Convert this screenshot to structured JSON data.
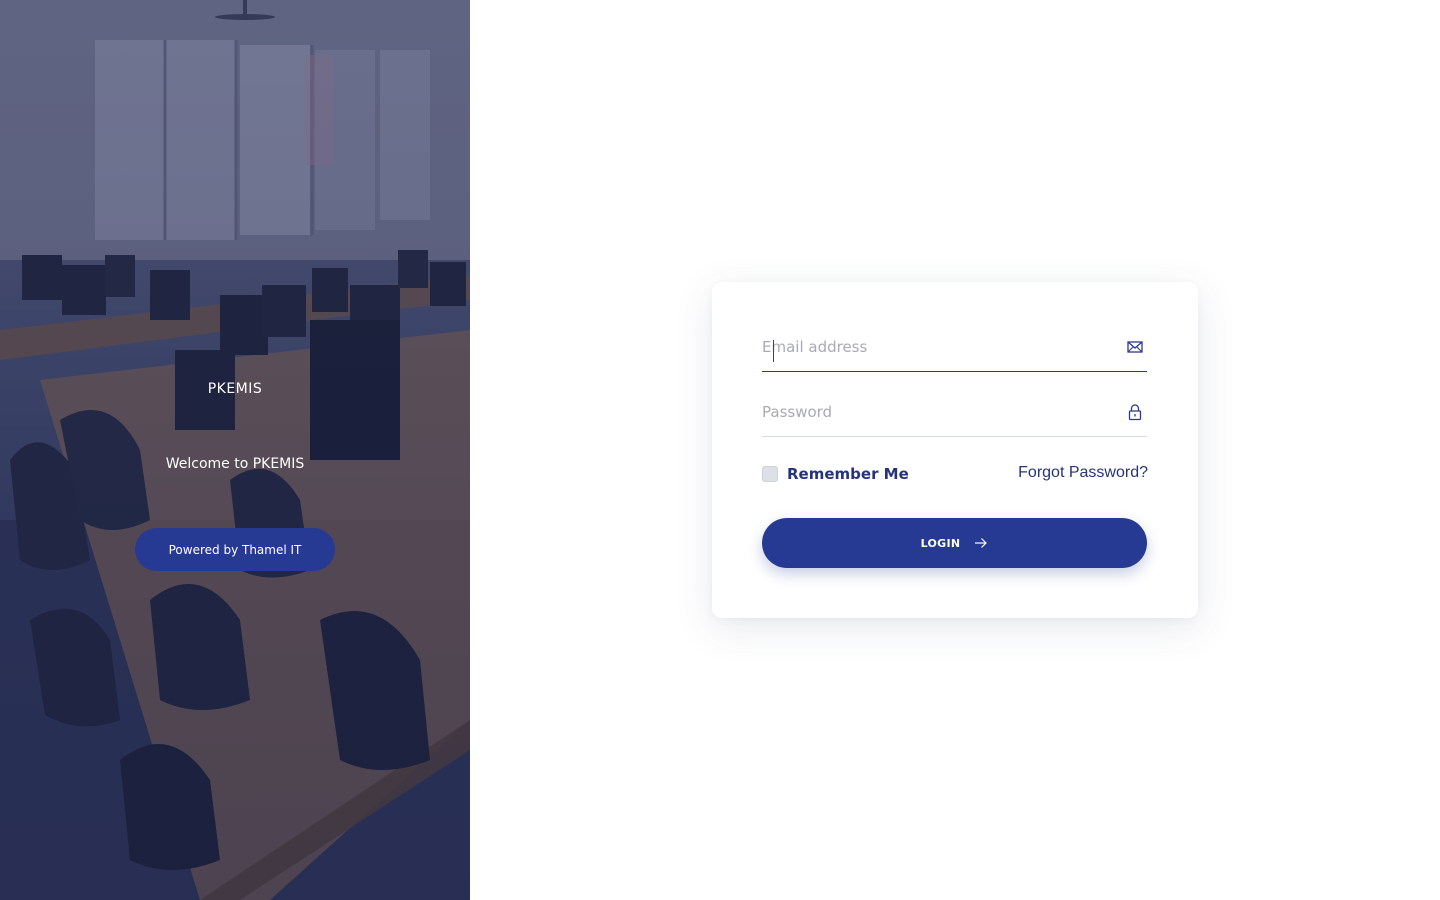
{
  "hero": {
    "brand": "PKEMIS",
    "welcome": "Welcome to PKEMIS",
    "powered_by": "Powered by Thamel IT",
    "background_image": "computer-lab-photo"
  },
  "login_form": {
    "email": {
      "placeholder": "Email address",
      "value": "",
      "icon": "envelope-icon"
    },
    "password": {
      "placeholder": "Password",
      "value": "",
      "icon": "lock-icon"
    },
    "remember_me": {
      "label": "Remember Me",
      "checked": false
    },
    "forgot_password": "Forgot Password?",
    "submit": {
      "label": "LOGIN",
      "icon": "arrow-right-icon"
    }
  },
  "colors": {
    "primary": "#263a94",
    "text_primary": "#27337a",
    "placeholder": "#a9abb4"
  }
}
